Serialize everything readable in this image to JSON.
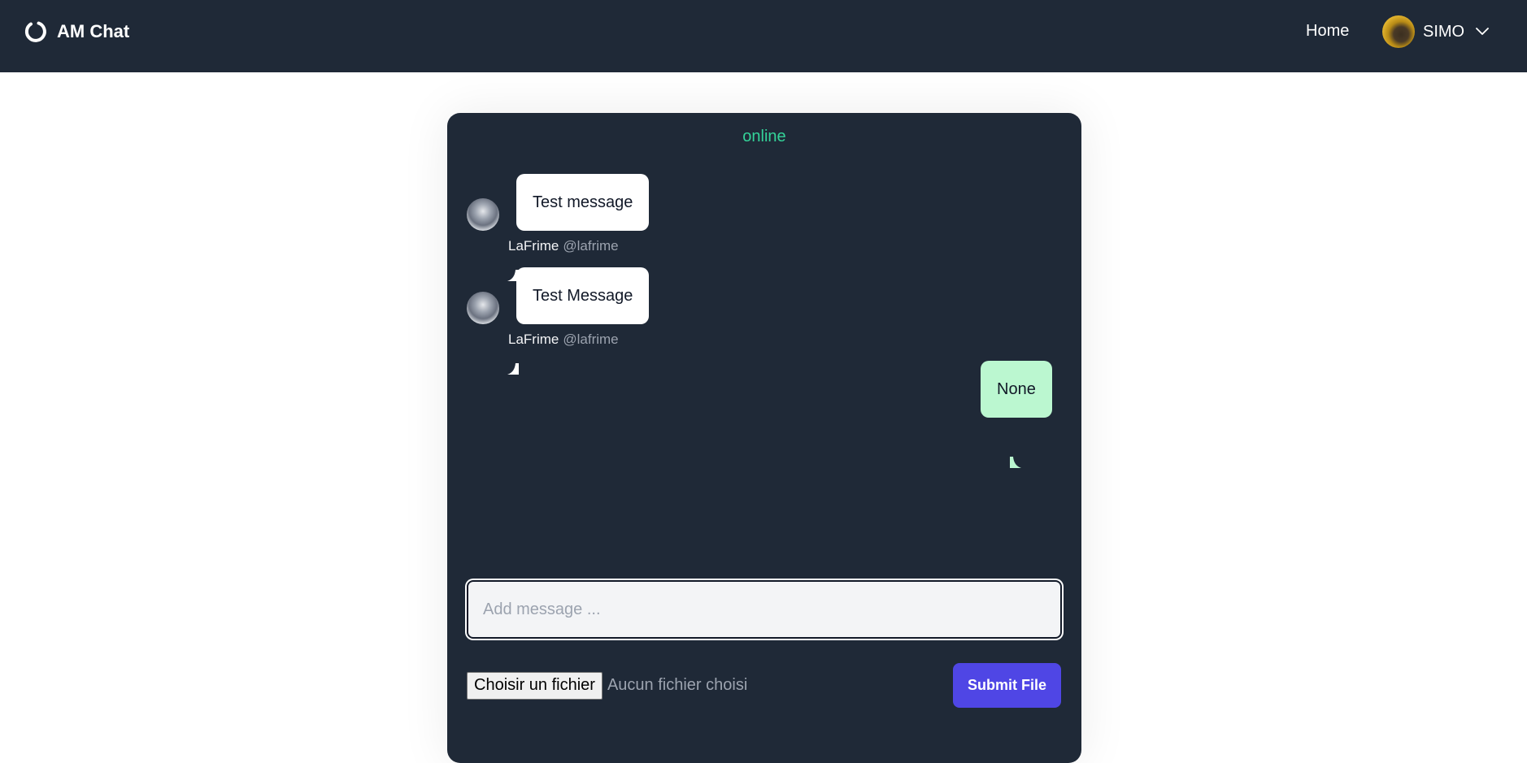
{
  "header": {
    "app_name": "AM Chat",
    "nav_home": "Home",
    "user_name": "SIMO",
    "logo_icon": "ring-logo-icon",
    "chevron_icon": "chevron-down-icon"
  },
  "chat": {
    "status": "online",
    "messages": [
      {
        "direction": "incoming",
        "text": "Test message",
        "sender_name": "LaFrime",
        "sender_handle": "@lafrime"
      },
      {
        "direction": "incoming",
        "text": "Test Message",
        "sender_name": "LaFrime",
        "sender_handle": "@lafrime"
      },
      {
        "direction": "outgoing",
        "text": "None"
      }
    ],
    "input": {
      "placeholder": "Add message ...",
      "value": ""
    },
    "file": {
      "button_label": "Choisir un fichier",
      "status": "Aucun fichier choisi"
    },
    "submit_label": "Submit File"
  },
  "colors": {
    "header_bg": "#1f2937",
    "status_green": "#34d399",
    "outgoing_bubble": "#bbf7d0",
    "submit_button": "#4f46e5"
  }
}
